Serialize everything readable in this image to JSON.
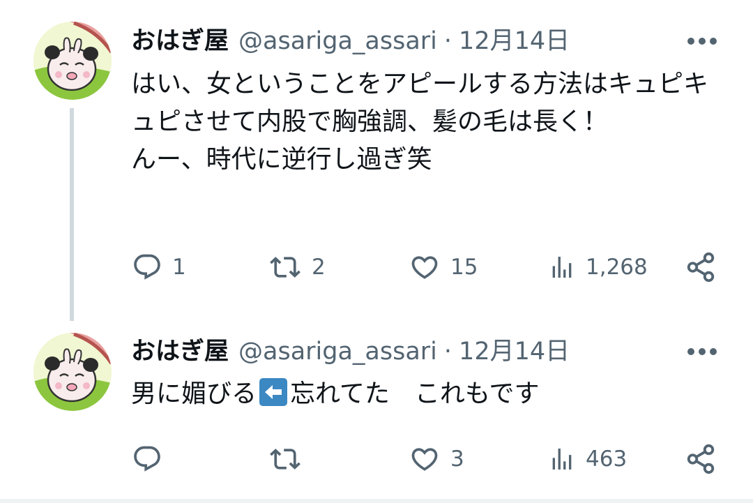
{
  "tweets": [
    {
      "author": {
        "name": "おはぎ屋",
        "handle": "@asariga_assari",
        "avatar_icon": "panda-rabbit-avatar"
      },
      "separator": "·",
      "date": "12月14日",
      "text": "はい、女ということをアピールする方法はキュピキュピさせて内股で胸強調、髪の毛は長く！\nんー、時代に逆行し過ぎ笑",
      "stats": {
        "replies": "1",
        "retweets": "2",
        "likes": "15",
        "views": "1,268"
      }
    },
    {
      "author": {
        "name": "おはぎ屋",
        "handle": "@asariga_assari",
        "avatar_icon": "panda-rabbit-avatar"
      },
      "separator": "·",
      "date": "12月14日",
      "text_before": "男に媚びる",
      "emoji_icon": "left-arrow-emoji",
      "text_after": "忘れてた　これもです",
      "stats": {
        "replies": "",
        "retweets": "",
        "likes": "3",
        "views": "463"
      }
    }
  ],
  "colors": {
    "text": "#0f1419",
    "secondary": "#536471",
    "thread_line": "#cfd9de",
    "emoji_blue": "#3b88c3"
  },
  "icons": [
    "reply-icon",
    "retweet-icon",
    "like-icon",
    "views-icon",
    "share-icon",
    "more-icon"
  ]
}
